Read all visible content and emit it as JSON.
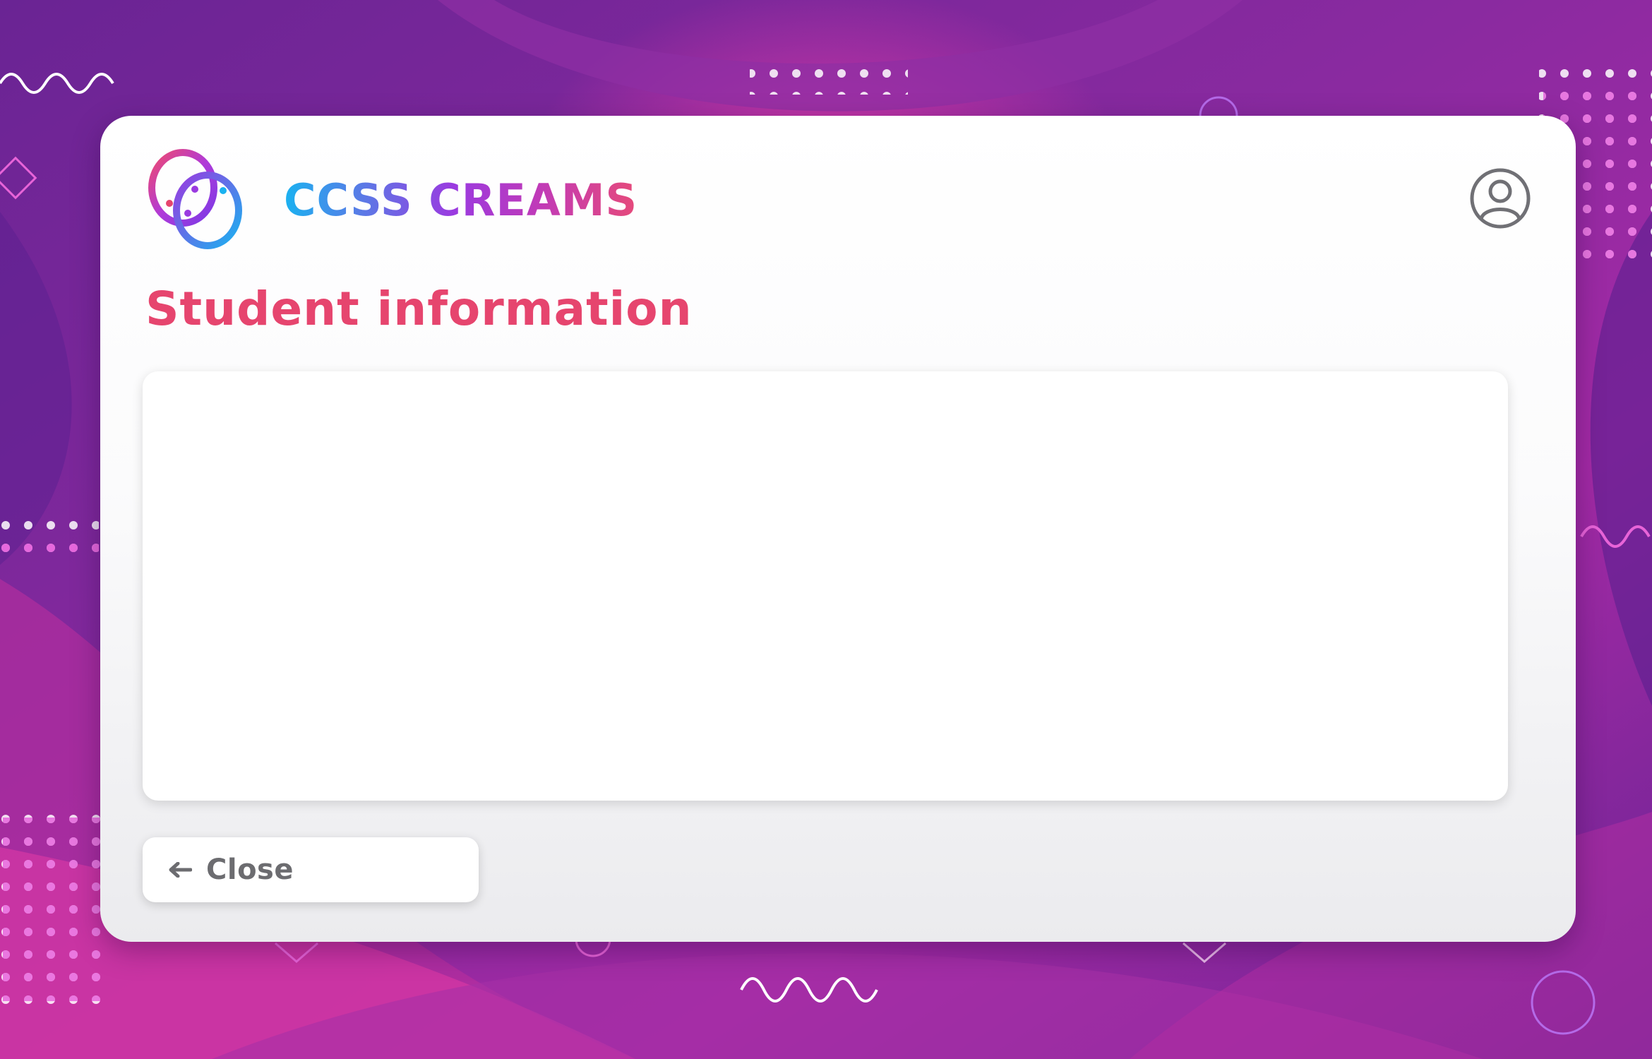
{
  "app": {
    "brand_name": "CCSS CREAMS",
    "logo_icon": "ccss-creams-logo",
    "account_icon": "user-account-icon"
  },
  "page": {
    "title": "Student information"
  },
  "footer": {
    "close_label": "Close",
    "close_icon": "arrow-left-icon"
  },
  "colors": {
    "title": "#e6456e",
    "background_primary": "#7a2a9e",
    "background_accent": "#d93ca8",
    "brand_gradient": [
      "#1ab2f0",
      "#9a3ae0",
      "#e64a7a"
    ],
    "button_text": "#6c6c70",
    "icon_gray": "#707075"
  }
}
